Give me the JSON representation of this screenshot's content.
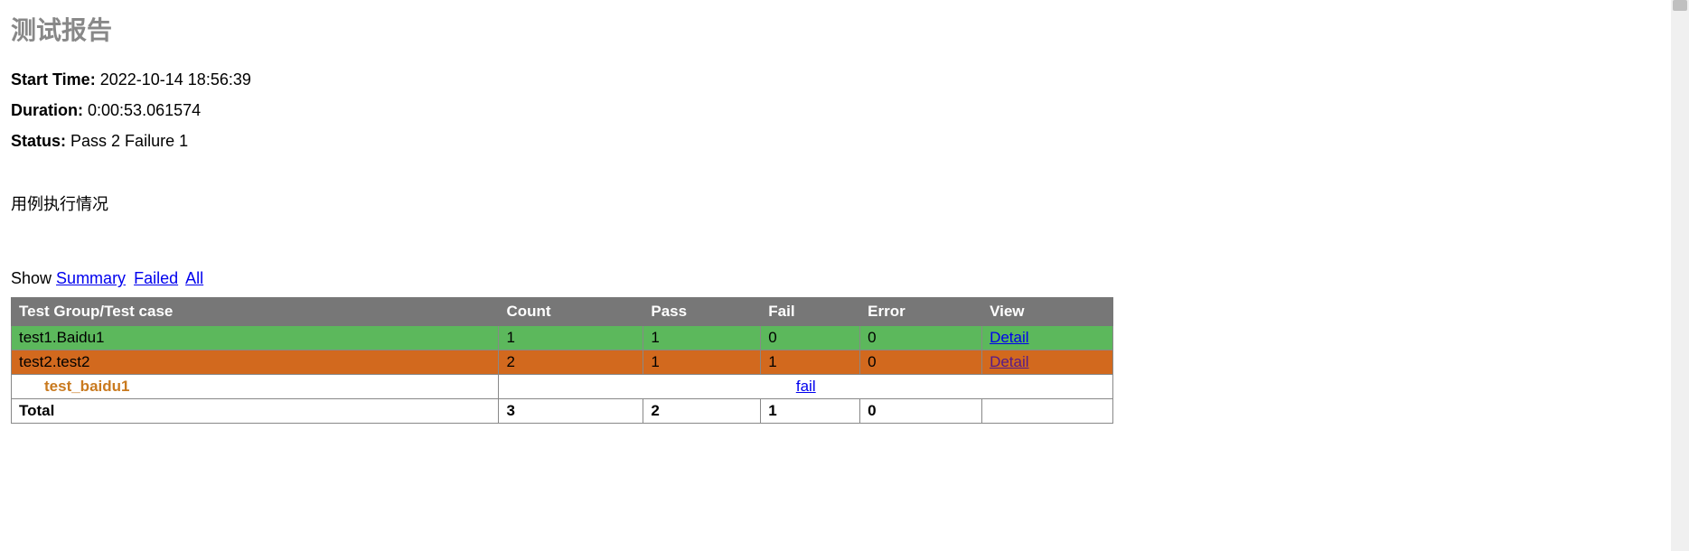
{
  "page": {
    "title": "测试报告"
  },
  "meta": {
    "start_time_label": "Start Time:",
    "start_time_value": "2022-10-14 18:56:39",
    "duration_label": "Duration:",
    "duration_value": "0:00:53.061574",
    "status_label": "Status:",
    "status_value": "Pass 2 Failure 1"
  },
  "section": {
    "heading": "用例执行情况"
  },
  "filters": {
    "show_label": "Show",
    "summary": "Summary",
    "failed": "Failed",
    "all": "All"
  },
  "table": {
    "headers": {
      "name": "Test Group/Test case",
      "count": "Count",
      "pass": "Pass",
      "fail": "Fail",
      "error": "Error",
      "view": "View"
    },
    "rows": [
      {
        "class": "row-pass",
        "name": "test1.Baidu1",
        "count": "1",
        "pass": "1",
        "fail": "0",
        "error": "0",
        "view": "Detail",
        "view_class": "link"
      },
      {
        "class": "row-fail",
        "name": "test2.test2",
        "count": "2",
        "pass": "1",
        "fail": "1",
        "error": "0",
        "view": "Detail",
        "view_class": "link visited"
      }
    ],
    "case_row": {
      "name": "test_baidu1",
      "result": "fail"
    },
    "total": {
      "label": "Total",
      "count": "3",
      "pass": "2",
      "fail": "1",
      "error": "0"
    }
  }
}
